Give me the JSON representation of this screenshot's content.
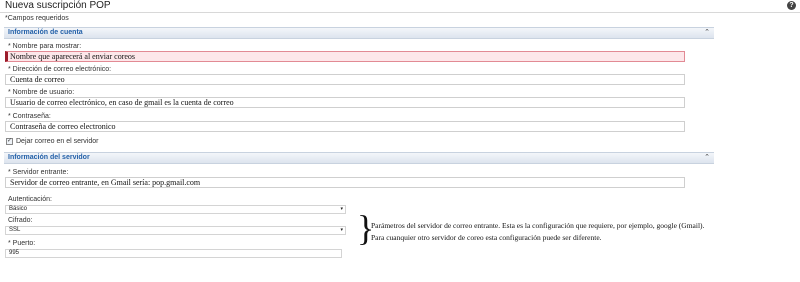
{
  "header": {
    "title": "Nueva suscripción POP",
    "help_icon": "?",
    "required_note": "*Campos requeridos"
  },
  "account_section": {
    "title": "Información de cuenta",
    "collapse_icon": "⌃",
    "display_name": {
      "label": "* Nombre para mostrar:",
      "value": "Nombre que aparecerá al enviar coreos"
    },
    "email": {
      "label": "* Dirección de correo electrónico:",
      "value": "Cuenta de correo"
    },
    "username": {
      "label": "* Nombre de usuario:",
      "value": "Usuario de correo electrónico, en caso de gmail es la cuenta de correo"
    },
    "password": {
      "label": "* Contraseña:",
      "value": "Contraseña de correo electronico"
    },
    "leave_on_server": {
      "label": "Dejar correo en el servidor",
      "checked": true,
      "check_mark": "✓"
    }
  },
  "server_section": {
    "title": "Información del servidor",
    "collapse_icon": "⌃",
    "incoming_server": {
      "label": "* Servidor entrante:",
      "value": "Servidor de correo entrante, en Gmail sería: pop.gmail.com"
    },
    "authentication": {
      "label": "Autenticación:",
      "value": "Básico"
    },
    "encryption": {
      "label": "Cifrado:",
      "value": "SSL"
    },
    "port": {
      "label": "* Puerto:",
      "value": "995"
    },
    "dropdown_arrow": "▾"
  },
  "annotation": {
    "brace": "}",
    "line1": "Parámetros del servidor de correo entrante. Esta es la configuración que requiere, por ejemplo, google (Gmail).",
    "line2": "Para cuanquier otro servidor de coreo esta configuración puede ser diferente."
  }
}
